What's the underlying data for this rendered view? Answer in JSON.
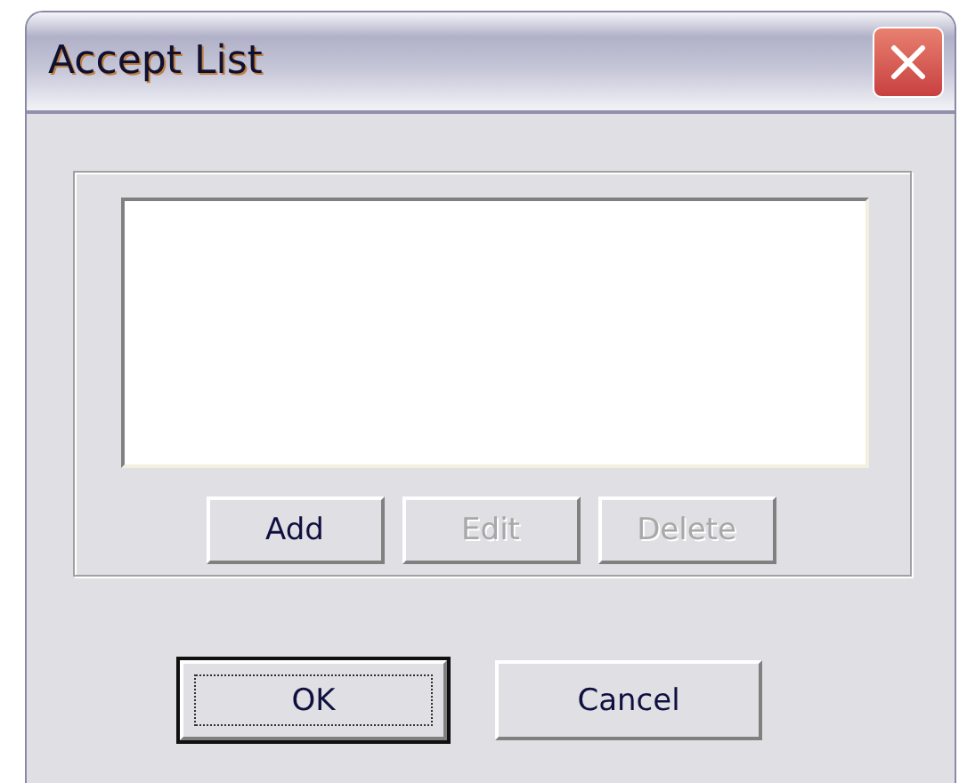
{
  "window": {
    "title": "Accept List"
  },
  "list_buttons": [
    {
      "label": "Add",
      "disabled": false
    },
    {
      "label": "Edit",
      "disabled": true
    },
    {
      "label": "Delete",
      "disabled": true
    }
  ],
  "dialog_buttons": [
    {
      "label": "OK",
      "focused": true
    },
    {
      "label": "Cancel",
      "focused": false
    }
  ]
}
